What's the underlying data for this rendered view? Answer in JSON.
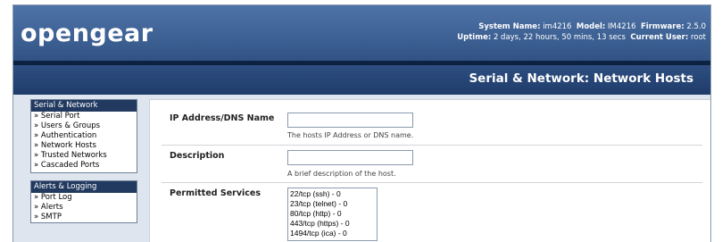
{
  "brand": {
    "logo": "opengear"
  },
  "system": {
    "line1": [
      {
        "label": "System Name:",
        "value": "im4216"
      },
      {
        "label": "Model:",
        "value": "IM4216"
      },
      {
        "label": "Firmware:",
        "value": "2.5.0"
      }
    ],
    "line2": [
      {
        "label": "Uptime:",
        "value": "2 days, 22 hours, 50 mins, 13 secs"
      },
      {
        "label": "Current User:",
        "value": "root"
      }
    ]
  },
  "page_title": "Serial & Network: Network Hosts",
  "sidebar": {
    "sections": [
      {
        "title": "Serial & Network",
        "items": [
          "» Serial Port",
          "» Users & Groups",
          "» Authentication",
          "» Network Hosts",
          "» Trusted Networks",
          "» Cascaded Ports"
        ]
      },
      {
        "title": "Alerts & Logging",
        "items": [
          "» Port Log",
          "» Alerts",
          "» SMTP"
        ]
      }
    ]
  },
  "form": {
    "ip": {
      "label": "IP Address/DNS Name",
      "value": "",
      "help": "The hosts IP Address or DNS name."
    },
    "description": {
      "label": "Description",
      "value": "",
      "help": "A brief description of the host."
    },
    "services": {
      "label": "Permitted Services",
      "options": [
        "22/tcp (ssh) - 0",
        "23/tcp (telnet) - 0",
        "80/tcp (http) - 0",
        "443/tcp (https) - 0",
        "1494/tcp (ica) - 0"
      ]
    }
  },
  "colors": {
    "header": "#2a4a7c",
    "sidebar_head": "#223a5f",
    "content_bg": "#dfe5ee"
  }
}
